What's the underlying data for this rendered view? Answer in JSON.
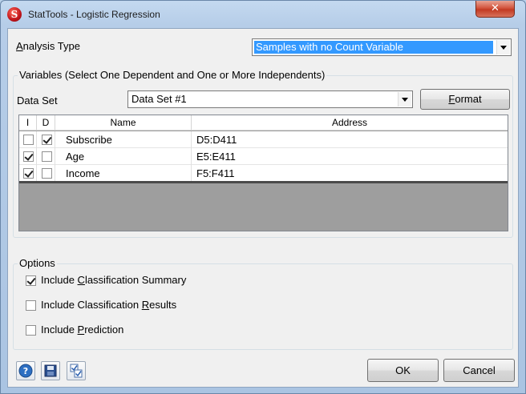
{
  "window": {
    "title": "StatTools - Logistic Regression",
    "close_glyph": "✕"
  },
  "analysis_type": {
    "label": "Analysis Type",
    "selected": "Samples with no Count Variable"
  },
  "variables_group": {
    "title": "Variables (Select One Dependent and One or More Independents)",
    "data_set_label": "Data Set",
    "data_set_selected": "Data Set #1",
    "format_button": "Format",
    "columns": [
      "I",
      "D",
      "Name",
      "Address"
    ],
    "rows": [
      {
        "independent": false,
        "dependent": true,
        "name": "Subscribe",
        "address": "D5:D411"
      },
      {
        "independent": true,
        "dependent": false,
        "name": "Age",
        "address": "E5:E411"
      },
      {
        "independent": true,
        "dependent": false,
        "name": "Income",
        "address": "F5:F411"
      }
    ]
  },
  "options_group": {
    "title": "Options",
    "items": [
      {
        "label": "Include Classification Summary",
        "checked": true
      },
      {
        "label": "Include Classification Results",
        "checked": false
      },
      {
        "label": "Include Prediction",
        "checked": false
      }
    ]
  },
  "footer": {
    "icons": [
      "help-icon",
      "save-icon",
      "checklist-icon"
    ],
    "ok_label": "OK",
    "cancel_label": "Cancel"
  },
  "colors": {
    "selection_highlight": "#3399ff",
    "close_button": "#c8452e"
  }
}
